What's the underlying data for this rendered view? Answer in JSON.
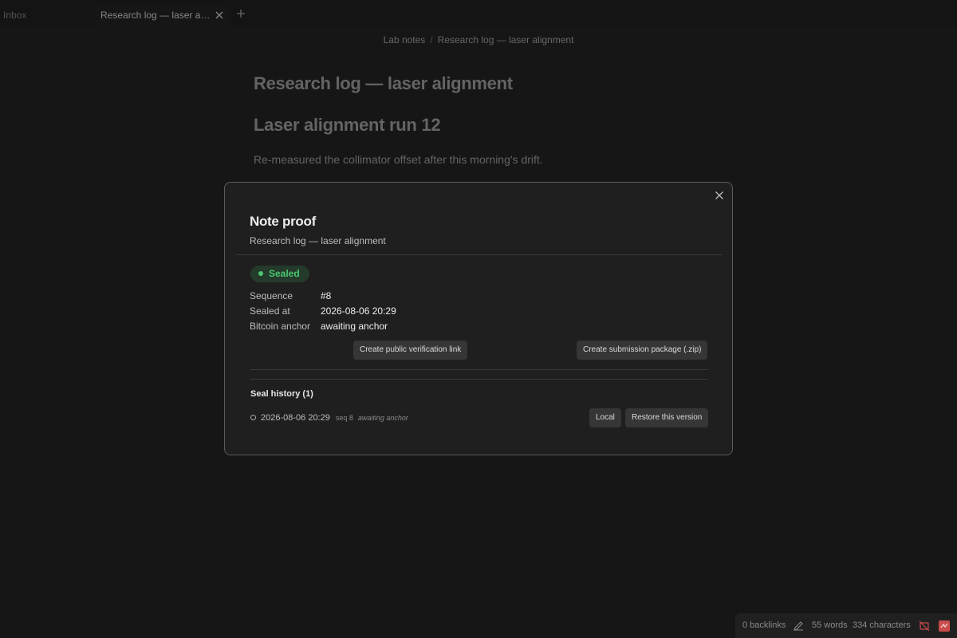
{
  "tabs": [
    {
      "label": "Inbox"
    },
    {
      "label": "Research log — laser alignment"
    }
  ],
  "breadcrumb": {
    "parent": "Lab notes",
    "separator": "/",
    "current": "Research log — laser alignment"
  },
  "note": {
    "title": "Research log — laser alignment",
    "heading": "Laser alignment run 12",
    "paragraph": "Re-measured the collimator offset after this morning's drift."
  },
  "modal": {
    "title": "Note proof",
    "subtitle": "Research log — laser alignment",
    "status": "Sealed",
    "status_color": "#4cc771",
    "details": [
      {
        "label": "Sequence",
        "value": "#8"
      },
      {
        "label": "Sealed at",
        "value": "2026-08-06 20:29"
      },
      {
        "label": "Bitcoin anchor",
        "value": "awaiting anchor"
      }
    ],
    "buttons": {
      "verification_link": "Create public verification link",
      "submission_package": "Create submission package (.zip)"
    },
    "history": {
      "heading": "Seal history (1)",
      "entries": [
        {
          "timestamp": "2026-08-06 20:29",
          "seq": "seq 8",
          "status": "awaiting anchor",
          "local_label": "Local",
          "restore_label": "Restore this version"
        }
      ]
    }
  },
  "statusbar": {
    "backlinks": "0 backlinks",
    "words": "55 words",
    "characters": "334 characters",
    "accent_color": "#c94b4b"
  }
}
